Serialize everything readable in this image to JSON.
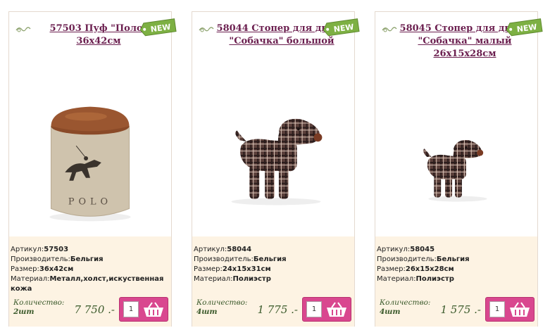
{
  "labels": {
    "article": "Артикул:",
    "manufacturer": "Производитель:",
    "size": "Размер:",
    "material": "Материал:",
    "quantity": "Количество:"
  },
  "products": [
    {
      "title": "57503 Пуф \"Поло\" 36х42см",
      "badge": "NEW",
      "image_text": "POLO",
      "article": "57503",
      "manufacturer": "Бельгия",
      "size": "36х42см",
      "material": "Металл,холст,искуственная кожа",
      "quantity": "2шт",
      "price": "7 750 .-",
      "qty_input": "1"
    },
    {
      "title": "58044 Стопер для двери \"Собачка\" большой",
      "badge": "NEW",
      "article": "58044",
      "manufacturer": "Бельгия",
      "size": "24х15х31см",
      "material": "Полиэстр",
      "quantity": "4шт",
      "price": "1 775 .-",
      "qty_input": "1"
    },
    {
      "title": "58045 Стопер для двери \"Собачка\" малый 26х15х28см",
      "badge": "NEW",
      "article": "58045",
      "manufacturer": "Бельгия",
      "size": "26х15х28см",
      "material": "Полиэстр",
      "quantity": "4шт",
      "price": "1 575 .-",
      "qty_input": "1"
    }
  ],
  "colors": {
    "title": "#6b1f4f",
    "panel": "#fdf3e3",
    "badge": "#7db043",
    "buy_button": "#d9478f",
    "price": "#3b5a2b"
  },
  "icons": [
    "swirl-ornament-icon",
    "new-badge-icon",
    "shopping-basket-icon"
  ]
}
